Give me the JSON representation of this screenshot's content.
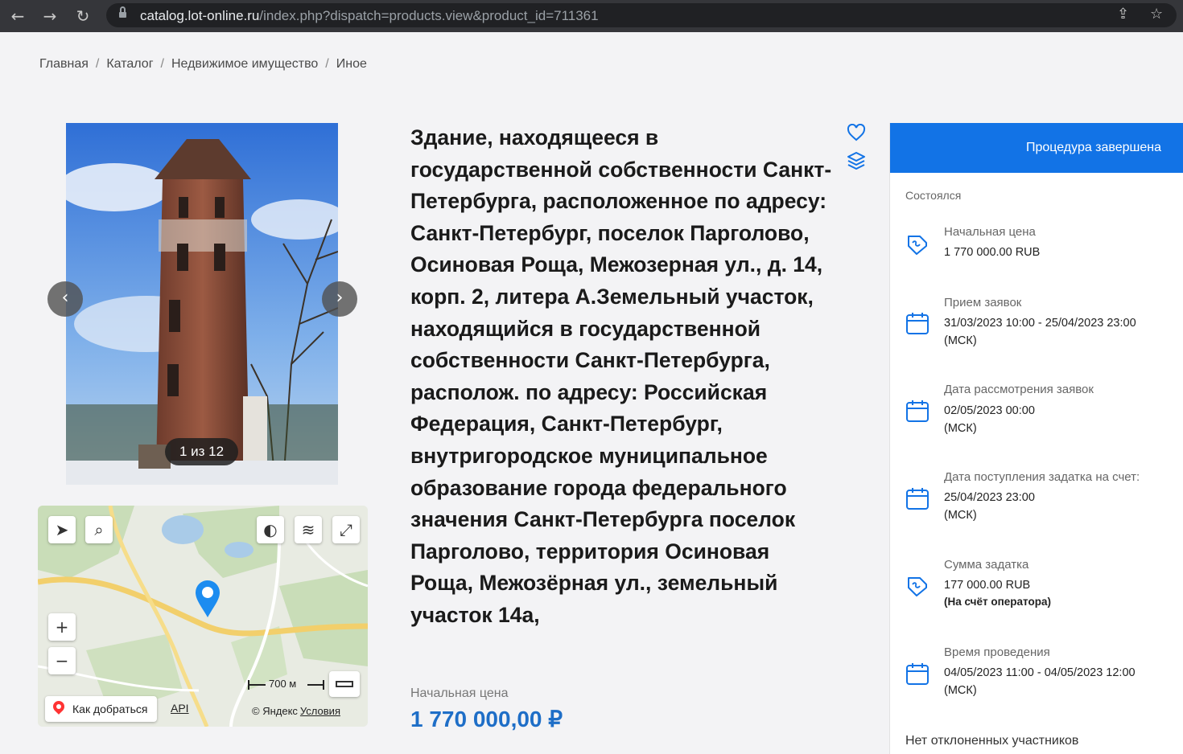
{
  "browser": {
    "url_host": "catalog.lot-online.ru",
    "url_path": "/index.php?dispatch=products.view&product_id=711361"
  },
  "breadcrumb": [
    "Главная",
    "Каталог",
    "Недвижимое имущество",
    "Иное"
  ],
  "gallery": {
    "counter": "1 из 12"
  },
  "map": {
    "route_label": "Как добраться",
    "api_label": "API",
    "scale_label": "700 м",
    "copyright": "© Яндекс",
    "terms": "Условия"
  },
  "lot": {
    "title": "Здание, находящееся в государственной собственности Санкт-Петербурга, расположенное по адресу: Санкт-Петербург, поселок Парголово, Осиновая Роща, Межозерная ул., д. 14, корп. 2, литера А.Земельный участок, находящийся в государственной собственности Санкт-Петербурга, располож. по адресу: Российская Федерация, Санкт-Петербург, внутригородское муниципальное образование города федерального значения Санкт-Петербурга поселок Парголово, территория Осиновая Роща, Межозёрная ул., земельный участок 14а,",
    "price_label": "Начальная цена",
    "price_value": "1 770 000,00 ₽"
  },
  "panel": {
    "header": "Процедура завершена",
    "status": "Состоялся",
    "items": [
      {
        "label": "Начальная цена",
        "value": "1 770 000.00 RUB",
        "icon": "price-tag-icon"
      },
      {
        "label": "Прием заявок",
        "value": "31/03/2023 10:00  - 25/04/2023 23:00",
        "tz": "(МСК)",
        "icon": "calendar-icon"
      },
      {
        "label": "Дата рассмотрения заявок",
        "value": "02/05/2023 00:00",
        "tz": "(МСК)",
        "icon": "calendar-icon"
      },
      {
        "label": "Дата поступления задатка на счет:",
        "value": "25/04/2023 23:00",
        "tz": "(МСК)",
        "icon": "calendar-icon"
      },
      {
        "label": "Сумма задатка",
        "value": "177 000.00 RUB",
        "note": "(На счёт оператора)",
        "icon": "price-tag-icon"
      },
      {
        "label": "Время проведения",
        "value": "04/05/2023 11:00 - 04/05/2023 12:00",
        "tz": "(МСК)",
        "icon": "calendar-icon"
      }
    ],
    "footer": "Нет отклоненных участников"
  },
  "colors": {
    "accent": "#1273e6",
    "price": "#1e6ec7",
    "browser_bar": "#35363a"
  }
}
